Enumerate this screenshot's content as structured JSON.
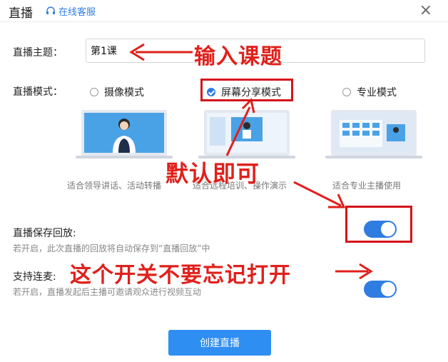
{
  "header": {
    "title": "直播",
    "service_label": "在线客服",
    "close_icon": "close-icon"
  },
  "topic": {
    "label": "直播主题：",
    "value": "第1课"
  },
  "mode": {
    "label": "直播模式：",
    "options": [
      {
        "label": "摄像模式",
        "caption": "适合领导讲话、活动转播",
        "checked": false
      },
      {
        "label": "屏幕分享模式",
        "caption": "适合远程培训、操作演示",
        "checked": true
      },
      {
        "label": "专业模式",
        "caption": "适合专业主播使用",
        "checked": false
      }
    ]
  },
  "save_replay": {
    "label": "直播保存回放:",
    "desc": "若开启，此次直播的回放将自动保存到“直播回放”中",
    "on": true
  },
  "mic_link": {
    "label": "支持连麦:",
    "desc": "若开启，直播发起后主播可邀请观众进行视频互动",
    "on": true
  },
  "create_button": {
    "label": "创建直播"
  },
  "annotations": {
    "input_topic": "输入课题",
    "default_ok": "默认即可",
    "remember_switch": "这个开关不要忘记打开"
  },
  "colors": {
    "accent": "#2f7de1",
    "button": "#2f8ef1",
    "annotation": "#e0201b"
  }
}
